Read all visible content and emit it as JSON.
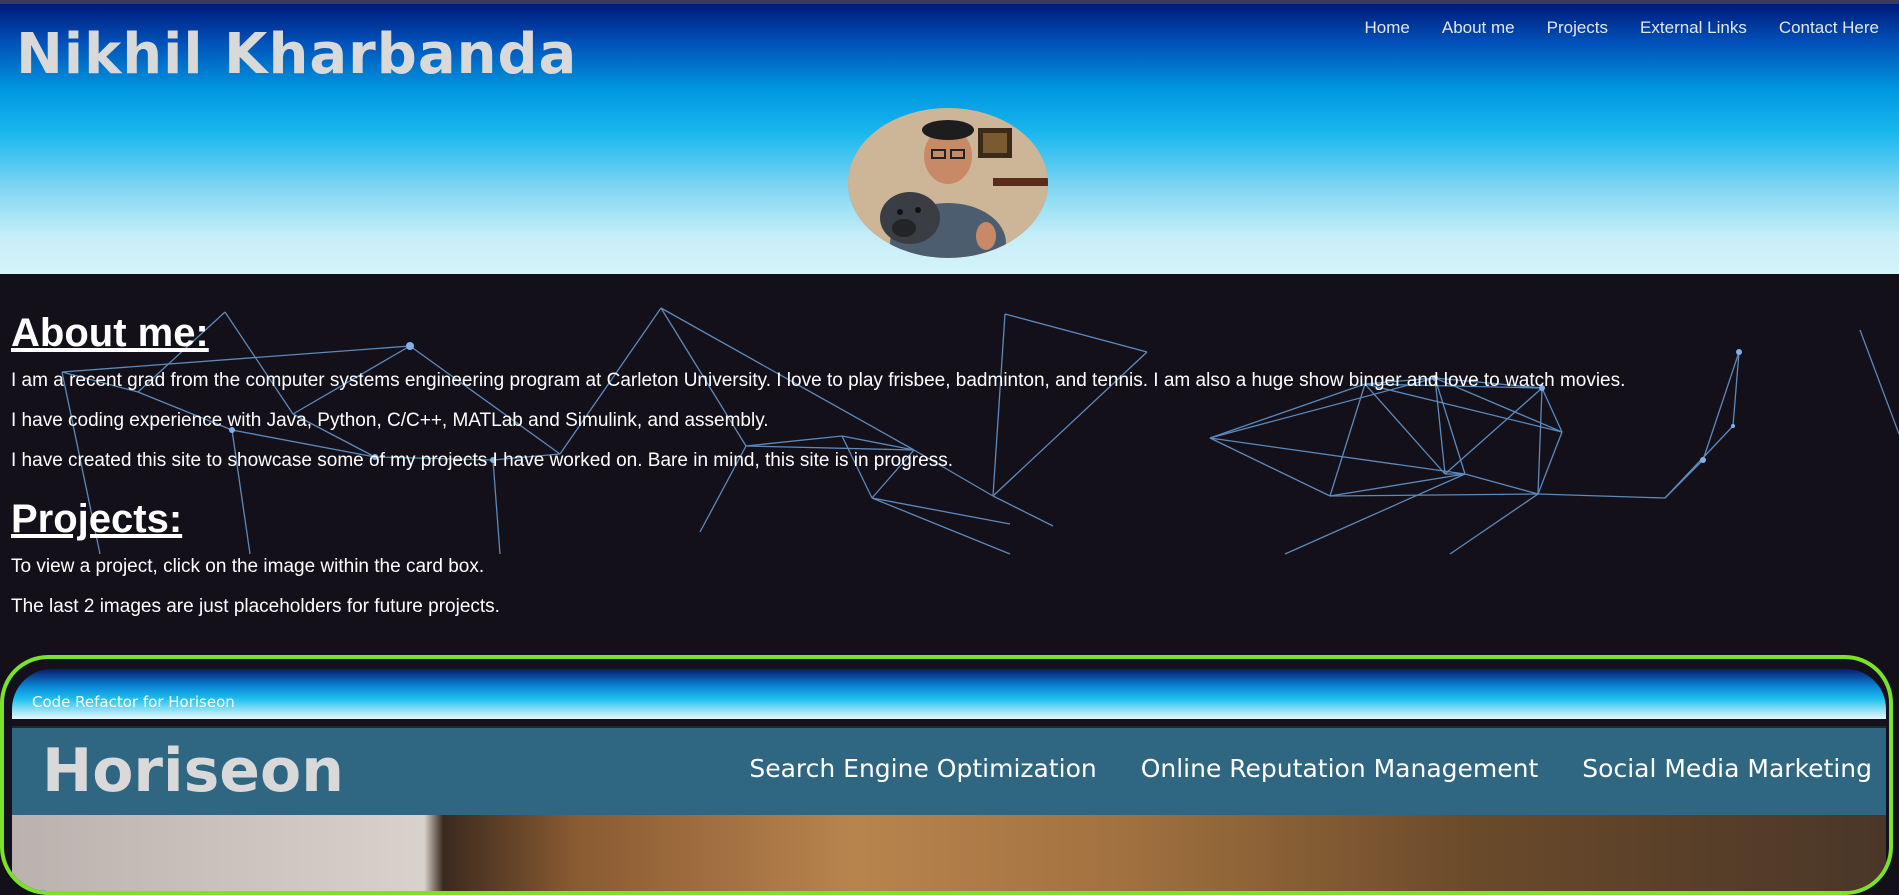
{
  "header": {
    "site_title": "Nikhil Kharbanda",
    "nav": [
      "Home",
      "About me",
      "Projects",
      "External Links",
      "Contact Here"
    ]
  },
  "about": {
    "heading": "About me:",
    "paragraphs": [
      "I am a recent grad from the computer systems engineering program at Carleton University. I love to play frisbee, badminton, and tennis. I am also a huge show binger and love to watch movies.",
      "I have coding experience with Java, Python, C/C++, MATLab and Simulink, and assembly.",
      "I have created this site to showcase some of my projects I have worked on. Bare in mind, this site is in progress."
    ]
  },
  "projects": {
    "heading": "Projects:",
    "paragraphs": [
      "To view a project, click on the image within the card box.",
      "The last 2 images are just placeholders for future projects."
    ],
    "card": {
      "title": "Code Refactor for Horiseon",
      "preview": {
        "logo": "Horiseon",
        "nav": [
          "Search Engine Optimization",
          "Online Reputation Management",
          "Social Media Marketing"
        ]
      }
    }
  },
  "colors": {
    "card_border": "#7be22a",
    "page_background": "#13101a",
    "network_lines": "#6a9fd8"
  }
}
